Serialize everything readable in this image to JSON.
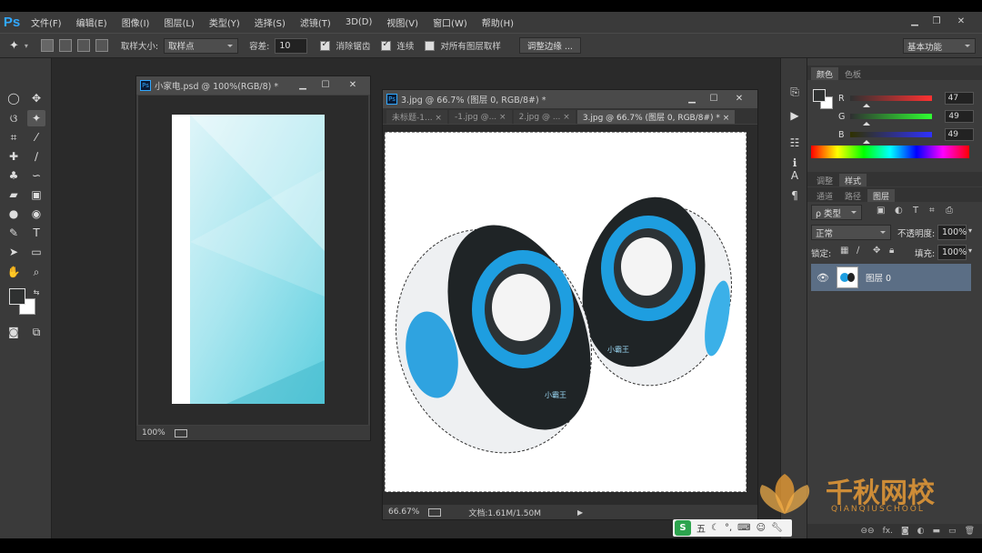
{
  "app": {
    "logo": "Ps"
  },
  "menu": [
    "文件(F)",
    "编辑(E)",
    "图像(I)",
    "图层(L)",
    "类型(Y)",
    "选择(S)",
    "滤镜(T)",
    "3D(D)",
    "视图(V)",
    "窗口(W)",
    "帮助(H)"
  ],
  "window_controls": {
    "minimize": "▁",
    "restore": "❐",
    "close": "✕"
  },
  "options": {
    "sample_size_label": "取样大小:",
    "sample_size_value": "取样点",
    "tolerance_label": "容差:",
    "tolerance_value": "10",
    "antialias_label": "消除锯齿",
    "contiguous_label": "连续",
    "all_layers_label": "对所有图层取样",
    "refine_edge_label": "调整边缘 ...",
    "workspace_value": "基本功能"
  },
  "doc1": {
    "title": "小家电.psd @ 100%(RGB/8) *",
    "zoom": "100%"
  },
  "doc2": {
    "title": "3.jpg @ 66.7% (图层 0, RGB/8#) *",
    "tabs": [
      "未标题-1... ×",
      "-1.jpg @... ×",
      "2.jpg @ ... ×",
      "3.jpg @ 66.7% (图层 0, RGB/8#) * ×"
    ],
    "zoom": "66.67%",
    "doc_info": "文档:1.61M/1.50M"
  },
  "speaker": {
    "brand_left": "小霸王",
    "brand_right": "小霸王"
  },
  "panels": {
    "color_tabs": [
      "颜色",
      "色板"
    ],
    "rgb": [
      {
        "label": "R",
        "value": "47"
      },
      {
        "label": "G",
        "value": "49"
      },
      {
        "label": "B",
        "value": "49"
      }
    ],
    "adjust_tabs": [
      "调整",
      "样式"
    ],
    "layer_tabs": [
      "通道",
      "路径",
      "图层"
    ],
    "filter_kind": "ρ 类型",
    "blend_mode": "正常",
    "opacity_label": "不透明度:",
    "opacity_value": "100%",
    "lock_label": "锁定:",
    "fill_label": "填充:",
    "fill_value": "100%",
    "layer_name": "图层 0"
  },
  "ime": {
    "badge": "S",
    "mode": "五"
  },
  "watermark": {
    "cn": "千秋网校",
    "en": "QIANQIUSCHOOL"
  },
  "colors": {
    "accent": "#31a8ff",
    "layer_selected": "#5b6e85",
    "speaker_blue": "#1e9ee0"
  }
}
